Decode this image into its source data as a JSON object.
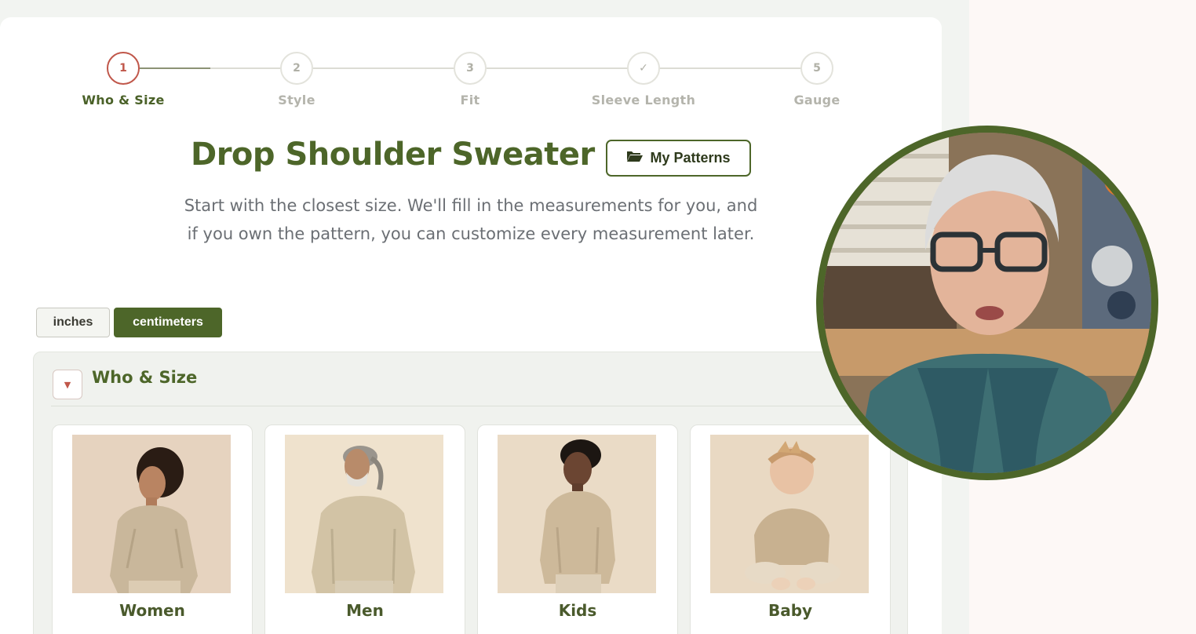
{
  "stepper": {
    "steps": [
      {
        "number": "1",
        "label": "Who & Size"
      },
      {
        "number": "2",
        "label": "Style"
      },
      {
        "number": "3",
        "label": "Fit"
      },
      {
        "number": "✓",
        "label": "Sleeve Length"
      },
      {
        "number": "5",
        "label": "Gauge"
      }
    ],
    "active_index": 0
  },
  "header": {
    "title": "Drop Shoulder Sweater",
    "my_patterns_label": "My Patterns",
    "subtitle_line1": "Start with the closest size. We'll fill in the measurements for you, and",
    "subtitle_line2": "if you own the pattern, you can customize every measurement later."
  },
  "units": {
    "inches_label": "inches",
    "centimeters_label": "centimeters",
    "selected": "centimeters"
  },
  "section": {
    "title": "Who & Size",
    "options": [
      {
        "label": "Women"
      },
      {
        "label": "Men"
      },
      {
        "label": "Kids"
      },
      {
        "label": "Baby"
      }
    ]
  },
  "colors": {
    "brand_green": "#4d6629",
    "accent_red": "#c0574a",
    "text_muted": "#6b6f74"
  },
  "icons": {
    "my_patterns": "folder-open-icon",
    "collapse": "caret-down-icon",
    "step_done": "checkmark"
  }
}
